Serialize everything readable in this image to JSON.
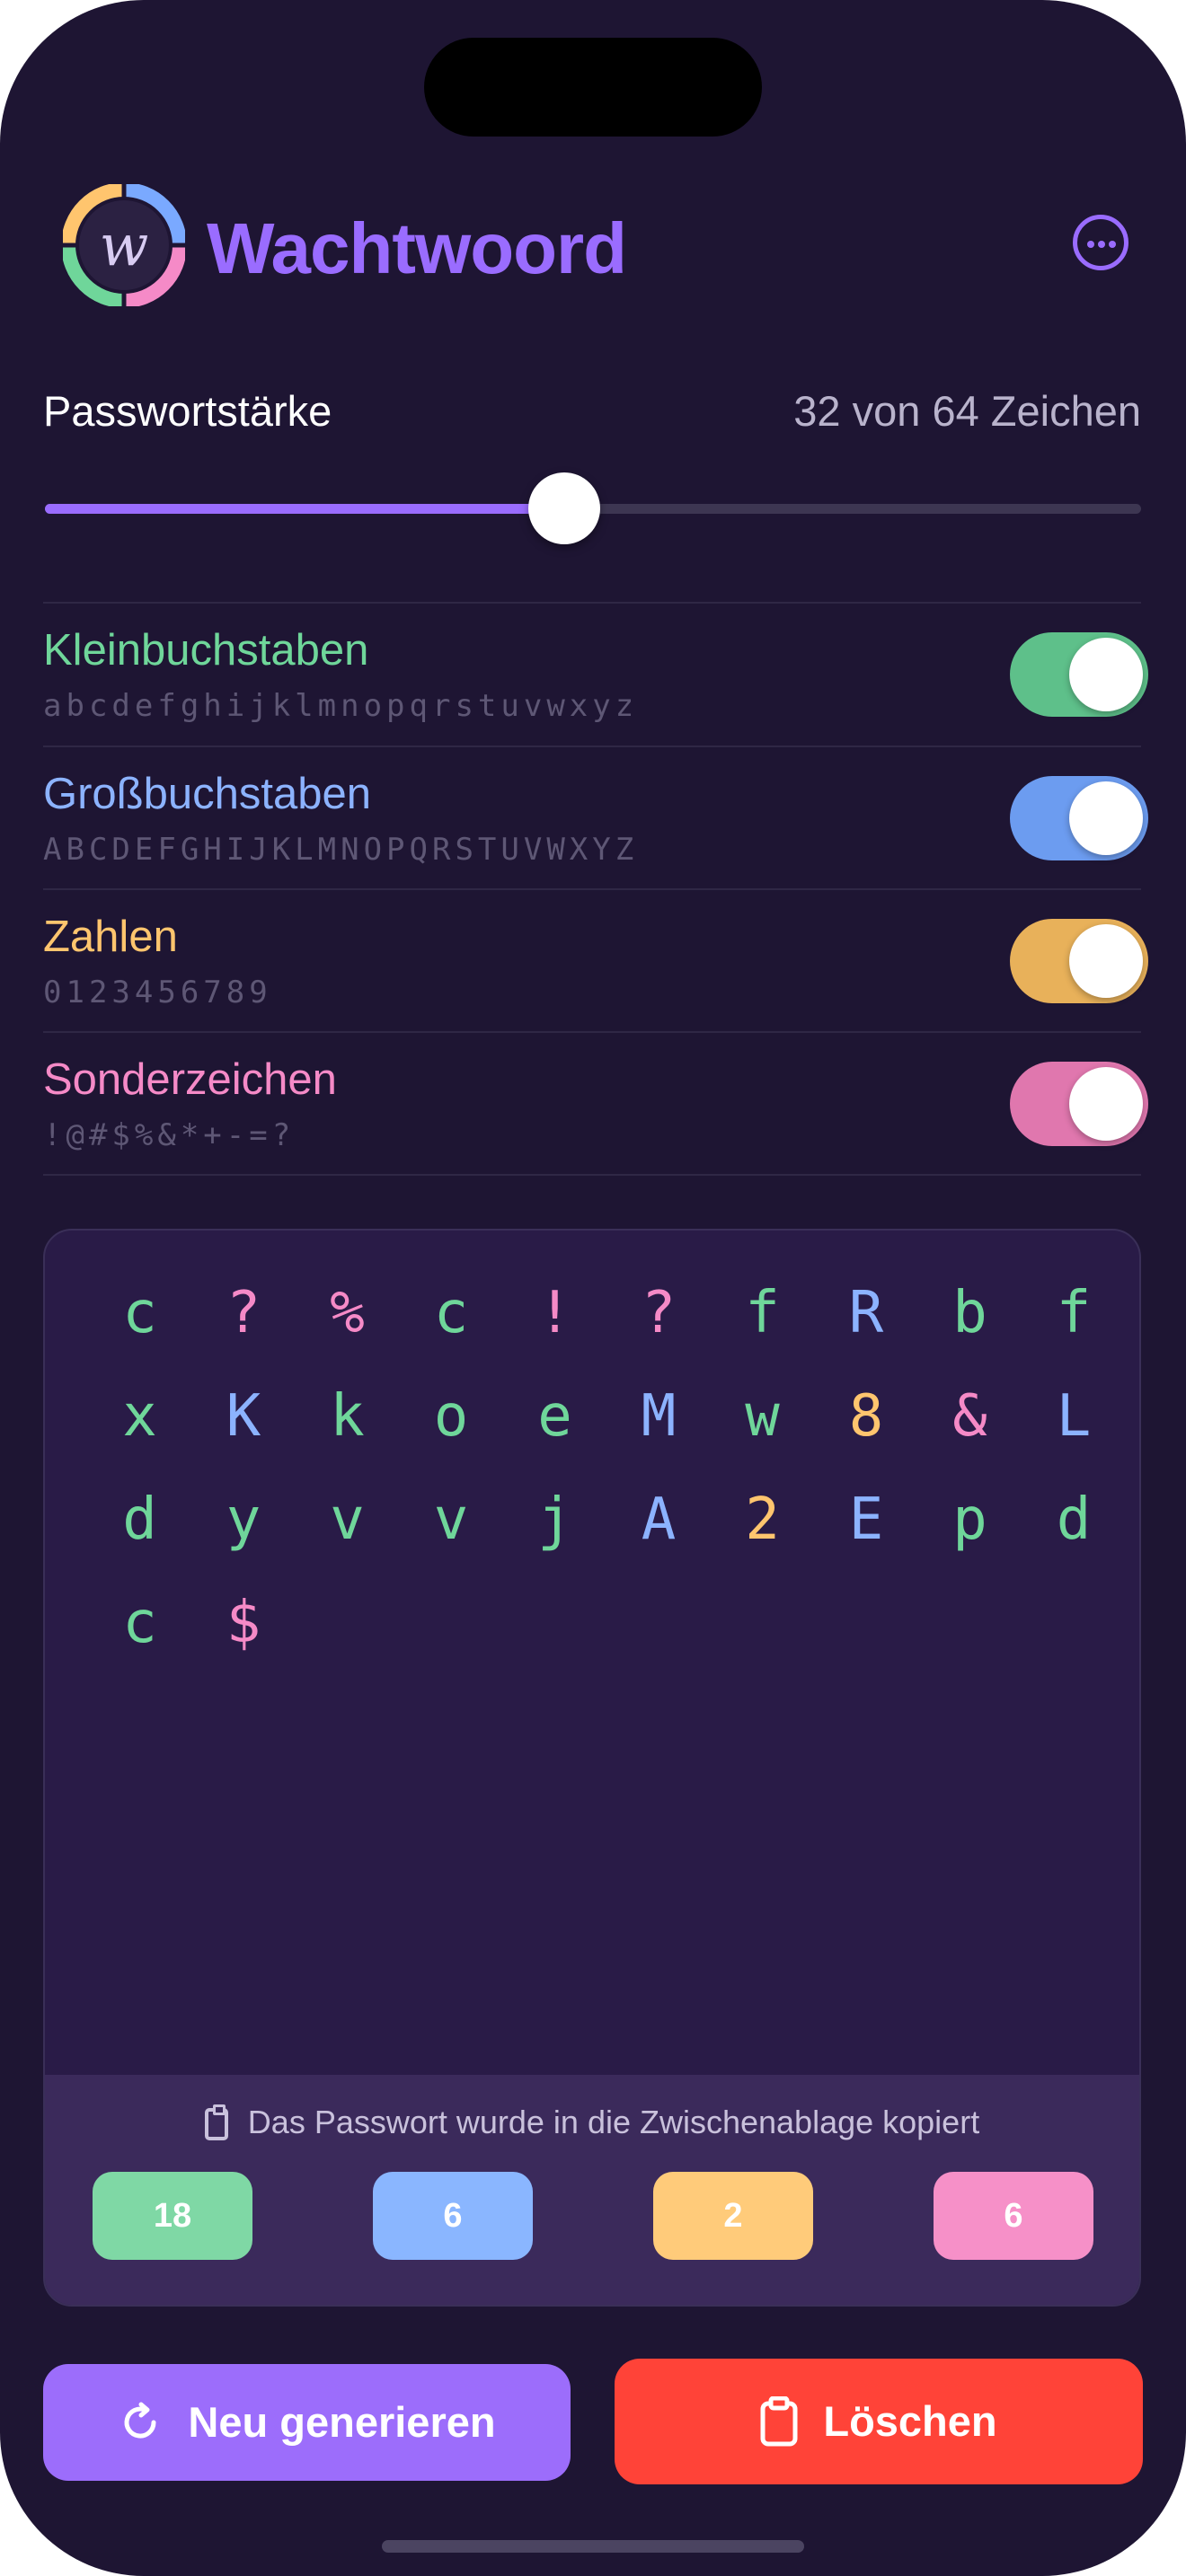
{
  "app": {
    "title": "Wachtwoord",
    "logo_letter": "w"
  },
  "strength": {
    "label": "Passwortstärke",
    "value_text": "32 von 64 Zeichen",
    "length": 32,
    "max": 64
  },
  "options": [
    {
      "title": "Kleinbuchstaben",
      "chars": "abcdefghijklmnopqrstuvwxyz",
      "color": "#6fd69a",
      "toggle_color": "#5ec08a",
      "enabled": true
    },
    {
      "title": "Großbuchstaben",
      "chars": "ABCDEFGHIJKLMNOPQRSTUVWXYZ",
      "color": "#8cb3ff",
      "toggle_color": "#6c9cf0",
      "enabled": true
    },
    {
      "title": "Zahlen",
      "chars": "0123456789",
      "color": "#ffc56e",
      "toggle_color": "#e8b15a",
      "enabled": true
    },
    {
      "title": "Sonderzeichen",
      "chars": "!@#$%&*+-=?",
      "color": "#f58ac7",
      "toggle_color": "#e077ae",
      "enabled": true
    }
  ],
  "password": {
    "characters": [
      {
        "c": "c",
        "t": 0
      },
      {
        "c": "?",
        "t": 3
      },
      {
        "c": "%",
        "t": 3
      },
      {
        "c": "c",
        "t": 0
      },
      {
        "c": "!",
        "t": 3
      },
      {
        "c": "?",
        "t": 3
      },
      {
        "c": "f",
        "t": 0
      },
      {
        "c": "R",
        "t": 1
      },
      {
        "c": "b",
        "t": 0
      },
      {
        "c": "f",
        "t": 0
      },
      {
        "c": "x",
        "t": 0
      },
      {
        "c": "K",
        "t": 1
      },
      {
        "c": "k",
        "t": 0
      },
      {
        "c": "o",
        "t": 0
      },
      {
        "c": "e",
        "t": 0
      },
      {
        "c": "M",
        "t": 1
      },
      {
        "c": "w",
        "t": 0
      },
      {
        "c": "8",
        "t": 2
      },
      {
        "c": "&",
        "t": 3
      },
      {
        "c": "L",
        "t": 1
      },
      {
        "c": "d",
        "t": 0
      },
      {
        "c": "y",
        "t": 0
      },
      {
        "c": "v",
        "t": 0
      },
      {
        "c": "v",
        "t": 0
      },
      {
        "c": "j",
        "t": 0
      },
      {
        "c": "A",
        "t": 1
      },
      {
        "c": "2",
        "t": 2
      },
      {
        "c": "E",
        "t": 1
      },
      {
        "c": "p",
        "t": 0
      },
      {
        "c": "d",
        "t": 0
      },
      {
        "c": "c",
        "t": 0
      },
      {
        "c": "$",
        "t": 3
      }
    ],
    "copied_message": "Das Passwort wurde in die Zwischenablage kopiert",
    "counts": [
      {
        "value": "18",
        "color": "#7fd8a5"
      },
      {
        "value": "6",
        "color": "#8ab6ff"
      },
      {
        "value": "2",
        "color": "#ffcb7a"
      },
      {
        "value": "6",
        "color": "#f690c8"
      }
    ]
  },
  "buttons": {
    "regenerate": {
      "label": "Neu generieren",
      "color": "#9c6dfb",
      "icon": "refresh-icon"
    },
    "delete": {
      "label": "Löschen",
      "color": "#ff4338",
      "icon": "clipboard-icon"
    }
  }
}
